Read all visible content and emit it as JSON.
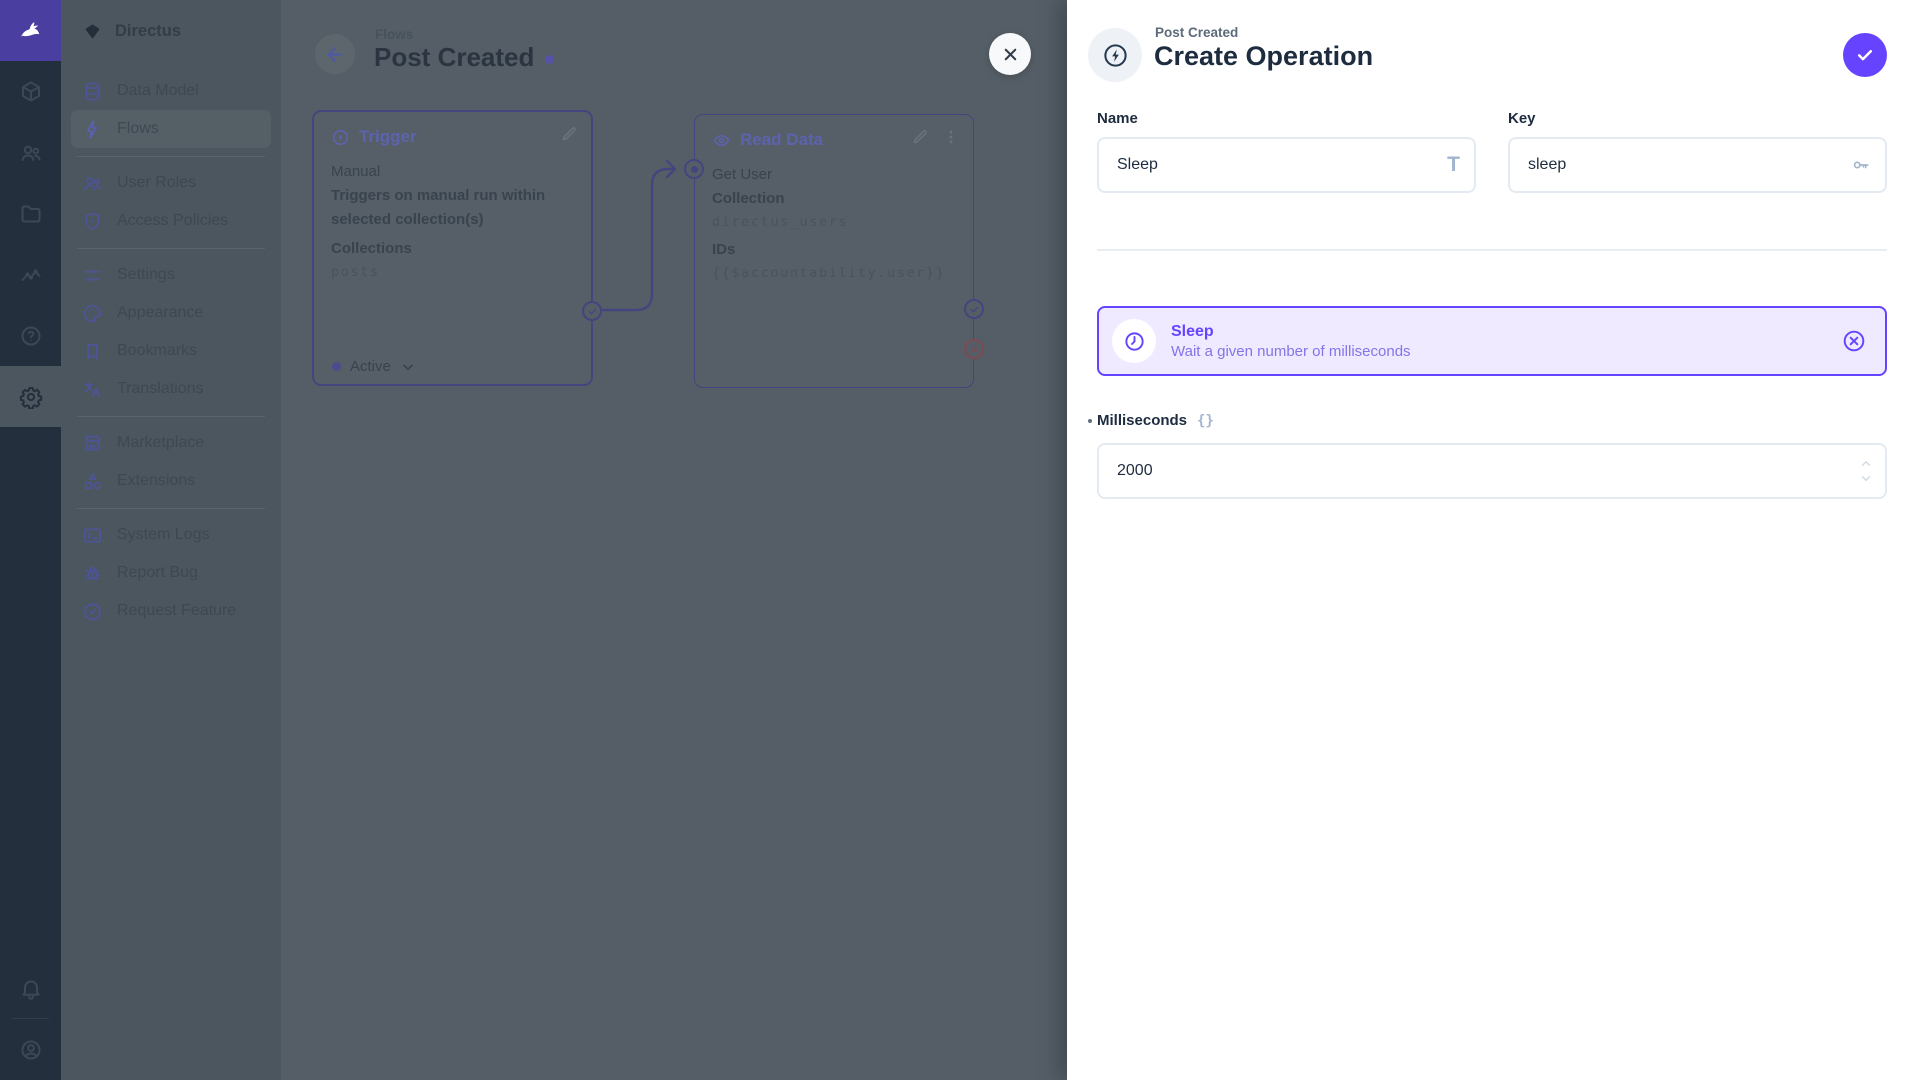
{
  "colors": {
    "primary": "#6644ff"
  },
  "modulebar": {
    "modules": [
      {
        "icon": "directus-logo",
        "active": false
      },
      {
        "icon": "data-model-cube",
        "active": false
      },
      {
        "icon": "user-directory",
        "active": false
      },
      {
        "icon": "file-library-folder",
        "active": false
      },
      {
        "icon": "insights-chart",
        "active": false
      },
      {
        "icon": "help-question",
        "active": false
      },
      {
        "icon": "settings-gear",
        "active": true
      },
      {
        "icon": "notifications-bell",
        "active": false
      },
      {
        "icon": "account-circle",
        "active": false
      }
    ]
  },
  "sidebar": {
    "project_name": "Directus",
    "groups": [
      {
        "items": [
          {
            "icon": "database",
            "label": "Data Model"
          },
          {
            "icon": "bolt",
            "label": "Flows",
            "active": true
          }
        ]
      },
      {
        "items": [
          {
            "icon": "people",
            "label": "User Roles"
          },
          {
            "icon": "shield",
            "label": "Access Policies"
          }
        ]
      },
      {
        "items": [
          {
            "icon": "tune",
            "label": "Settings"
          },
          {
            "icon": "palette",
            "label": "Appearance"
          },
          {
            "icon": "bookmark",
            "label": "Bookmarks"
          },
          {
            "icon": "translate",
            "label": "Translations"
          }
        ]
      },
      {
        "items": [
          {
            "icon": "storefront",
            "label": "Marketplace"
          },
          {
            "icon": "category",
            "label": "Extensions"
          }
        ]
      },
      {
        "items": [
          {
            "icon": "terminal",
            "label": "System Logs"
          },
          {
            "icon": "bug",
            "label": "Report Bug"
          },
          {
            "icon": "verified",
            "label": "Request Feature"
          }
        ]
      }
    ]
  },
  "flow": {
    "breadcrumb": "Flows",
    "title": "Post Created",
    "trigger_panel": {
      "title": "Trigger",
      "type": "Manual",
      "description": "Triggers on manual run within selected collection(s)",
      "collections_label": "Collections",
      "collections_value": "posts",
      "status": "Active"
    },
    "read_data_panel": {
      "title": "Read Data",
      "name": "Get User",
      "collection_label": "Collection",
      "collection_value": "directus_users",
      "ids_label": "IDs",
      "ids_value": "{{$accountability.user}}"
    }
  },
  "drawer": {
    "breadcrumb": "Post Created",
    "title": "Create Operation",
    "name_field": {
      "label": "Name",
      "value": "Sleep"
    },
    "key_field": {
      "label": "Key",
      "value": "sleep"
    },
    "operation": {
      "title": "Sleep",
      "description": "Wait a given number of milliseconds"
    },
    "milliseconds_field": {
      "label": "Milliseconds",
      "value": "2000",
      "braces_icon": "{}"
    }
  }
}
